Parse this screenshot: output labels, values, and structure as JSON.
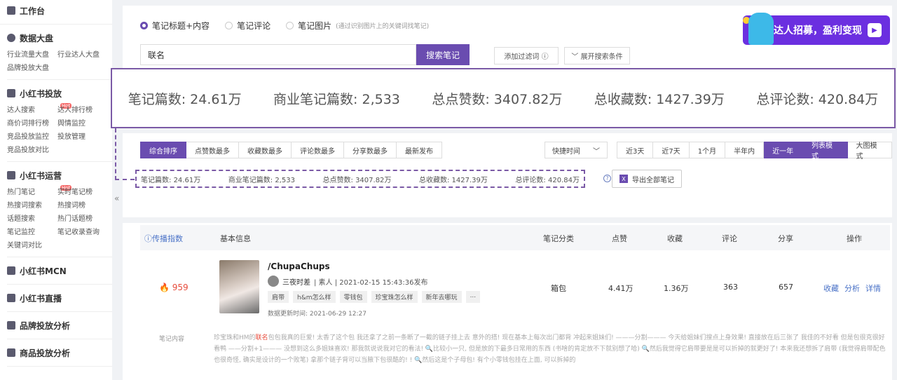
{
  "sidebar": {
    "workbench": "工作台",
    "sections": [
      {
        "title": "数据大盘",
        "icon": "pie-chart-icon",
        "items": [
          {
            "label": "行业流量大盘"
          },
          {
            "label": "行业达人大盘"
          },
          {
            "label": "品牌投放大盘"
          }
        ]
      },
      {
        "title": "小红书投放",
        "icon": "briefcase-icon",
        "items": [
          {
            "label": "达人搜索",
            "tag": "Hot"
          },
          {
            "label": "达人排行榜",
            "tag": "Hot"
          },
          {
            "label": "商价词排行榜"
          },
          {
            "label": "舆情监控",
            "tag": "Beta"
          },
          {
            "label": "竞品投放监控"
          },
          {
            "label": "投放管理"
          },
          {
            "label": "竞品投放对比"
          }
        ]
      },
      {
        "title": "小红书运营",
        "icon": "chart-icon",
        "items": [
          {
            "label": "热门笔记",
            "tag": "Hot"
          },
          {
            "label": "实时笔记榜"
          },
          {
            "label": "热搜词搜索"
          },
          {
            "label": "热搜词榜"
          },
          {
            "label": "话题搜索"
          },
          {
            "label": "热门话题榜"
          },
          {
            "label": "笔记监控"
          },
          {
            "label": "笔记收录查询"
          },
          {
            "label": "关键词对比"
          }
        ]
      },
      {
        "title": "小红书MCN",
        "icon": "building-icon",
        "items": []
      },
      {
        "title": "小红书直播",
        "icon": "video-icon",
        "items": []
      },
      {
        "title": "品牌投放分析",
        "icon": "bag-icon",
        "items": []
      },
      {
        "title": "商品投放分析",
        "icon": "bag-icon",
        "items": []
      }
    ],
    "collapse": "«"
  },
  "search": {
    "radios": [
      {
        "label": "笔记标题+内容",
        "selected": true
      },
      {
        "label": "笔记评论",
        "selected": false
      },
      {
        "label": "笔记图片",
        "selected": false,
        "hint": "(通过识别图片上的关键词找笔记)"
      }
    ],
    "value": "联名",
    "button": "搜索笔记",
    "add_filter": "添加过滤词 ⓘ",
    "expand": "﹀ 展开搜索条件"
  },
  "banner": {
    "text": "达人招募，盈利变现",
    "arrow": "▶"
  },
  "big_stats": [
    {
      "label": "笔记篇数: ",
      "value": "24.61万"
    },
    {
      "label": "商业笔记篇数: ",
      "value": "2,533"
    },
    {
      "label": "总点赞数: ",
      "value": "3407.82万"
    },
    {
      "label": "总收藏数: ",
      "value": "1427.39万"
    },
    {
      "label": "总评论数: ",
      "value": "420.84万"
    }
  ],
  "sorts": [
    {
      "label": "综合排序",
      "active": true
    },
    {
      "label": "点赞数最多"
    },
    {
      "label": "收藏数最多"
    },
    {
      "label": "评论数最多"
    },
    {
      "label": "分享数最多"
    },
    {
      "label": "最新发布"
    }
  ],
  "quick_time": {
    "label": "快捷时间",
    "arrow": "﹀"
  },
  "time_ranges": [
    {
      "label": "近3天"
    },
    {
      "label": "近7天"
    },
    {
      "label": "1个月"
    },
    {
      "label": "半年内"
    },
    {
      "label": "近一年",
      "active": true
    }
  ],
  "modes": [
    {
      "label": "列表模式",
      "active": true
    },
    {
      "label": "大图模式"
    }
  ],
  "small_stats": [
    {
      "label": "笔记篇数: ",
      "value": "24.61万"
    },
    {
      "label": "商业笔记篇数: ",
      "value": "2,533"
    },
    {
      "label": "总点赞数: ",
      "value": "3407.82万"
    },
    {
      "label": "总收藏数: ",
      "value": "1427.39万"
    },
    {
      "label": "总评论数: ",
      "value": "420.84万"
    }
  ],
  "export": {
    "label": "导出全部笔记",
    "icon_text": "X"
  },
  "table": {
    "headers": {
      "spread": "ⓘ传播指数",
      "info": "基本信息",
      "category": "笔记分类",
      "likes": "点赞",
      "collects": "收藏",
      "comments": "评论",
      "shares": "分享",
      "ops": "操作"
    },
    "rows": [
      {
        "spread": "🔥 959",
        "title": "/ChupaChups",
        "author": "三夜时差",
        "author_meta": "| 素人 | 2021-02-15 15:43:36发布",
        "tags": [
          "肩带",
          "h&m怎么样",
          "零钱包",
          "珍宝珠怎么样",
          "新年去哪玩",
          "..."
        ],
        "updated": "数据更新时间: 2021-06-29 12:27",
        "category": "箱包",
        "likes": "4.41万",
        "collects": "1.36万",
        "comments": "363",
        "shares": "657",
        "ops": [
          "收藏",
          "分析",
          "详情"
        ]
      }
    ],
    "content_label": "笔记内容",
    "content_pre": "珍宝珠和HM的",
    "content_hl": "联名",
    "content_post": "包包我真的巨爱! 太香了这个包 我还拿了之前一条断了一截的链子挂上去 意外的搭! 现在基本上每次出门都背 冲起来姐妹们! ———分割——— 今天给姐妹们搜点上身效果! 直接放在后三张了 我佳的不好看 但是包很克很好看鸭 ——分割+1——— 没想到这么多姐妹喜欢! 那我就说说我对它的看法! 🔍比较小一只, 但是放的下最多日常用的东西 (书啥的肯定放不下就别想了哈) 🔍然后我觉得它肩带要是是可以折掉的就更好了! 本来我还想拆了肩带 (我觉得肩带配色也很奇怪, 确实是设计的一个败笔) 拿那个链子背可以当腋下包很酷的! ! 🔍然后这是个子母包! 有个小零钱包挂在上面, 可以拆掉的"
  }
}
